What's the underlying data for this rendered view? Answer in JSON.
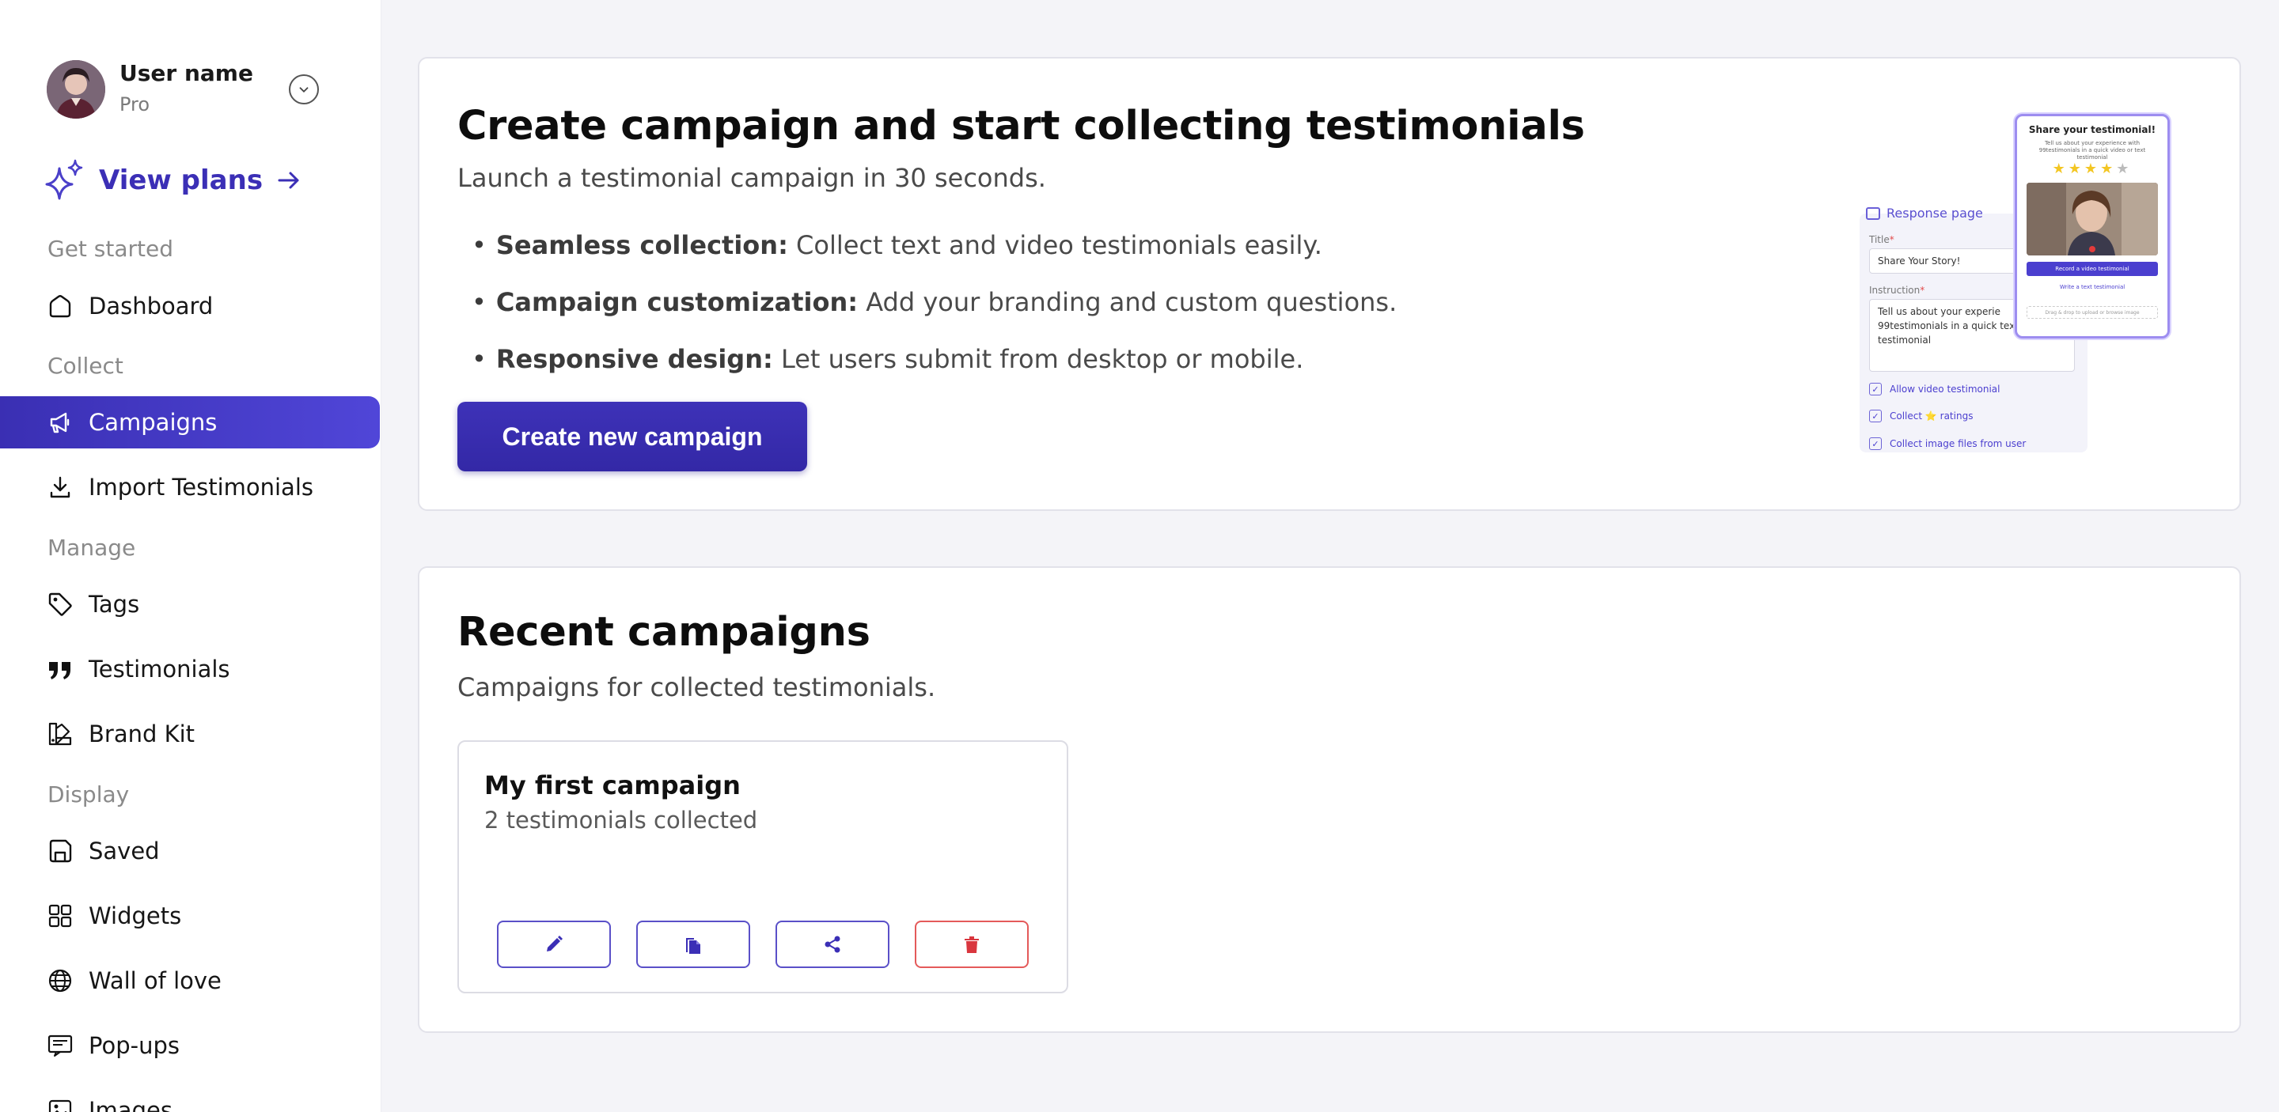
{
  "user": {
    "name": "User name",
    "plan": "Pro"
  },
  "view_plans": {
    "label": "View plans"
  },
  "sidebar": {
    "sections": [
      {
        "label": "Get started"
      },
      {
        "label": "Collect"
      },
      {
        "label": "Manage"
      },
      {
        "label": "Display"
      }
    ],
    "items": [
      {
        "label": "Dashboard",
        "icon": "home-icon",
        "active": false
      },
      {
        "label": "Campaigns",
        "icon": "megaphone-icon",
        "active": true
      },
      {
        "label": "Import Testimonials",
        "icon": "download-icon",
        "active": false
      },
      {
        "label": "Tags",
        "icon": "tag-icon",
        "active": false
      },
      {
        "label": "Testimonials",
        "icon": "quote-icon",
        "active": false
      },
      {
        "label": "Brand Kit",
        "icon": "brand-kit-icon",
        "active": false
      },
      {
        "label": "Saved",
        "icon": "saved-icon",
        "active": false
      },
      {
        "label": "Widgets",
        "icon": "widgets-icon",
        "active": false
      },
      {
        "label": "Wall of love",
        "icon": "globe-icon",
        "active": false
      },
      {
        "label": "Pop-ups",
        "icon": "popup-icon",
        "active": false
      },
      {
        "label": "Images",
        "icon": "image-icon",
        "active": false
      }
    ]
  },
  "hero": {
    "title": "Create campaign and start collecting testimonials",
    "subtitle": "Launch a testimonial campaign in 30 seconds.",
    "bullets": [
      {
        "bold": "Seamless collection:",
        "text": " Collect text and video testimonials easily."
      },
      {
        "bold": "Campaign customization:",
        "text": " Add your branding and custom questions."
      },
      {
        "bold": "Responsive design:",
        "text": " Let users submit from desktop or mobile."
      }
    ],
    "cta_label": "Create new campaign",
    "preview": {
      "response_page_label": "Response page",
      "title_label": "Title",
      "title_value": "Share Your Story!",
      "instruction_label": "Instruction",
      "instruction_value": "Tell us about your experie 99testimonials in a quick text testimonial",
      "checks": [
        "Allow video testimonial",
        "Collect ⭐ ratings",
        "Collect image files from user"
      ],
      "phone_title": "Share your testimonial!",
      "phone_desc": "Tell us about your experience with 99testimonials in a quick video or text testimonial",
      "rating_stars": 4,
      "rating_max": 5,
      "record_label": "Record a video testimonial",
      "write_label": "Write a text testimonial",
      "drop_label": "Drag & drop to upload or browse image"
    }
  },
  "recent": {
    "title": "Recent campaigns",
    "subtitle": "Campaigns for collected testimonials.",
    "campaigns": [
      {
        "name": "My first campaign",
        "count_text": "2 testimonials collected"
      }
    ]
  },
  "colors": {
    "accent": "#3b2fb6",
    "danger": "#d9363e",
    "background": "#f4f4f8"
  }
}
